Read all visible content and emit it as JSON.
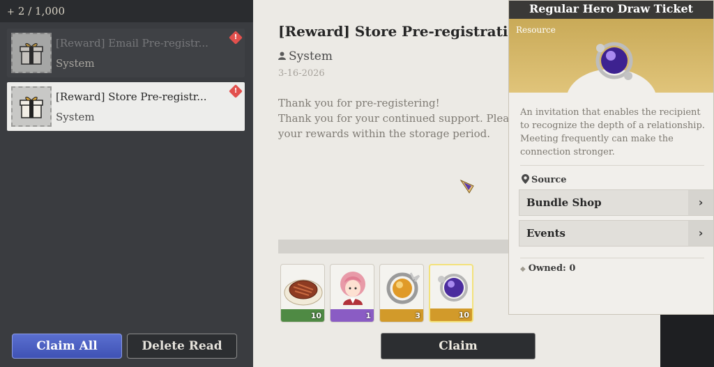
{
  "mailbox": {
    "count_text": "2 / 1,000",
    "items": [
      {
        "title": "[Reward] Email Pre-registr...",
        "sender": "System",
        "state": "read"
      },
      {
        "title": "[Reward] Store Pre-registr...",
        "sender": "System",
        "state": "selected"
      }
    ],
    "claim_all_label": "Claim All",
    "delete_read_label": "Delete Read"
  },
  "mail": {
    "title": "[Reward] Store Pre-registration",
    "sender": "System",
    "date": "3-16-2026",
    "body_line1": "Thank you for pre-registering!",
    "body_line2": "Thank you for your continued support. Plea",
    "body_line3": "your rewards within the storage period.",
    "rewards": [
      {
        "icon": "steak-icon",
        "qty": "10",
        "rarity_color": "#4f8a44"
      },
      {
        "icon": "hero-portrait-icon",
        "qty": "1",
        "rarity_color": "#8a5cc4"
      },
      {
        "icon": "golden-orb-icon",
        "qty": "3",
        "rarity_color": "#d29a2a"
      },
      {
        "icon": "purple-orb-icon",
        "qty": "10",
        "rarity_color": "#d29a2a"
      }
    ],
    "claim_label": "Claim"
  },
  "tooltip": {
    "title": "Regular Hero Draw Ticket",
    "category": "Resource",
    "description": "An invitation that enables the recipient to recognize the depth of a relationship. Meeting frequently can make the connection stronger.",
    "source_heading": "Source",
    "sources": [
      "Bundle Shop",
      "Events"
    ],
    "owned_text": "Owned: 0"
  },
  "colors": {
    "accent_blue": "#4a5ec4",
    "alert_red": "#e2504d",
    "gold": "#d29a2a"
  }
}
